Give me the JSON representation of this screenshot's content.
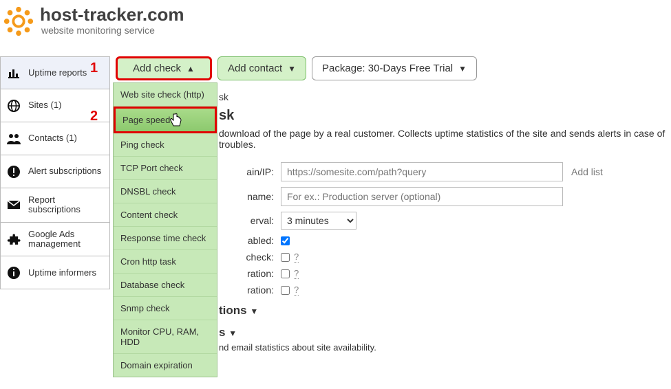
{
  "brand": {
    "title": "host-tracker.com",
    "subtitle": "website monitoring service"
  },
  "annotations": {
    "num1": "1",
    "num2": "2"
  },
  "toolbar": {
    "add_check": "Add check",
    "add_contact": "Add contact",
    "package": "Package: 30-Days Free Trial"
  },
  "dropdown": {
    "items": [
      "Web site check (http)",
      "Page speed",
      "Ping check",
      "TCP Port check",
      "DNSBL check",
      "Content check",
      "Response time check",
      "Cron http task",
      "Database check",
      "Snmp check",
      "Monitor CPU, RAM, HDD",
      "Domain expiration"
    ]
  },
  "sidebar": {
    "items": [
      "Uptime reports",
      "Sites (1)",
      "Contacts (1)",
      "Alert subscriptions",
      "Report subscriptions",
      "Google Ads management",
      "Uptime informers"
    ]
  },
  "content": {
    "trunc_top": "sk",
    "task_title_suffix": "sk",
    "task_desc_prefix": " download of the page by a real customer. Collects uptime statistics of the site and sends alerts in case of troubles.",
    "form": {
      "domain_label": "ain/IP:",
      "domain_placeholder": "https://somesite.com/path?query",
      "add_list": "Add list",
      "name_label": "name:",
      "name_placeholder": "For ex.: Production server (optional)",
      "interval_label": "erval:",
      "interval_value": "3 minutes",
      "enabled_label": "abled:",
      "check_label": "check:",
      "ration1_label": "ration:",
      "ration2_label": "ration:"
    },
    "section1": "tions",
    "section2": "s",
    "section2_note": "nd email statistics about site availability."
  }
}
